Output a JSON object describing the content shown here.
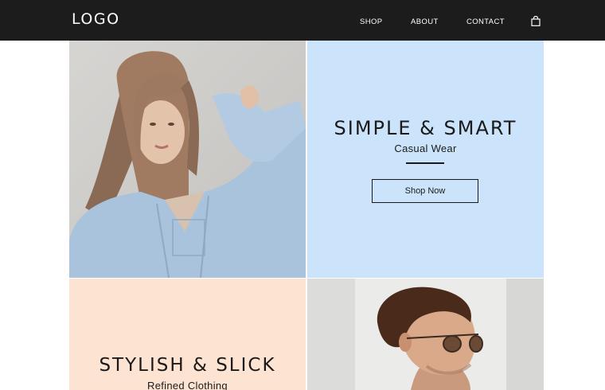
{
  "header": {
    "logo": "LOGO",
    "nav": [
      "SHOP",
      "ABOUT",
      "CONTACT"
    ],
    "cart_icon": "shopping-bag-icon"
  },
  "hero_tile": {
    "title": "SIMPLE & SMART",
    "subtitle": "Casual Wear",
    "button_label": "Shop Now",
    "background": "#cce4fb"
  },
  "second_tile": {
    "title": "STYLISH & SLICK",
    "subtitle": "Refined Clothing",
    "background": "#fde3d2"
  },
  "colors": {
    "nav_background": "#1c1c1c",
    "text": "#1a1a1a"
  }
}
